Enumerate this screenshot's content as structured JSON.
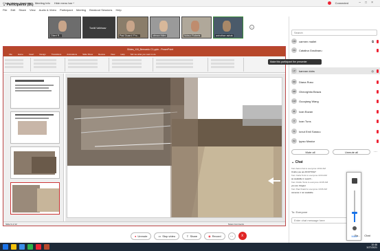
{
  "webex": {
    "title_items": [
      "Cisco Webex Meetings",
      "Meeting Info",
      "Hide menu bar ^"
    ],
    "status": "Connected",
    "menu": [
      "File",
      "Edit",
      "Share",
      "View",
      "Audio & Video",
      "Participant",
      "Meeting",
      "Breakout Sessions",
      "Help"
    ]
  },
  "videos": [
    {
      "label": "Obert R..."
    },
    {
      "label": "Tushil Vaibhaav"
    },
    {
      "label": "Paul Duard / Fro..."
    },
    {
      "label": "ottman thilex"
    },
    {
      "label": "Nobuo Roberts"
    },
    {
      "label": "aniruthan ashak"
    }
  ],
  "ppt": {
    "title": "Slides_XIII_Bernardo C1.pptx - PowerPoint",
    "tabs": [
      "File",
      "Home",
      "Insert",
      "Design",
      "Transitions",
      "Animations",
      "Slide Show",
      "Review",
      "View",
      "Help",
      "Tell me what you want to do"
    ],
    "status_left": "Slide 9 of 12",
    "status_right": "Notes  Comments",
    "thumbs": [
      "5",
      "6",
      "7",
      "8"
    ]
  },
  "participants": {
    "header": "Participants (16)",
    "search_placeholder": "Search",
    "tooltip": "Make this participant the presenter",
    "list": [
      {
        "initials": "CM",
        "name": "carmen mallet"
      },
      {
        "initials": "CG",
        "name": "Catalina Gradinaru"
      },
      {
        "initials": "",
        "name": ""
      },
      {
        "initials": "LP",
        "name": "kannan dobs"
      },
      {
        "initials": "DR",
        "name": "Diana Rusu"
      },
      {
        "initials": "GB",
        "name": "Gheorghita Beaza"
      },
      {
        "initials": "GW",
        "name": "Guoqiang Wang"
      },
      {
        "initials": "IB",
        "name": "Ioan Bozan"
      },
      {
        "initials": "IT",
        "name": "Ioan Tuns"
      },
      {
        "initials": "IS",
        "name": "Ionut Emil Saracu"
      },
      {
        "initials": "IM",
        "name": "Ippso Mastur"
      }
    ],
    "mute_all": "Mute all",
    "unmute_all": "Unmute all"
  },
  "chat": {
    "header": "Chat",
    "log": [
      "from Aaron Kai to everyone   10:02 AM",
      "Ovidiu you are ROOTING?",
      "from Carla Tonis to everyone   10:04 AM",
      "as available in search...",
      "from Ovidiu Tonis to everyone   10:05 AM",
      "you are Volgast",
      "from Paul Duard to everyone   10:06 AM",
      "cameras 1 not available"
    ],
    "to_label": "To:  Everyone",
    "input_placeholder": "Enter chat message here",
    "volume_label": "Mute",
    "volume_level": 0.3
  },
  "controls": {
    "unmute": "Unmute",
    "stop_video": "Stop video",
    "share": "Share",
    "record": "Record",
    "more": "...",
    "end": "x"
  },
  "panel_footer": {
    "participants_btn": "Pa...",
    "chat_btn": "Chat"
  },
  "taskbar": {
    "time": "10:46",
    "date": "3/27/2021"
  },
  "colors": {
    "webex_end": "#e02424",
    "ppt_accent": "#b7472a",
    "taskbar": "#1e2a38",
    "accent": "#1a73e8"
  }
}
